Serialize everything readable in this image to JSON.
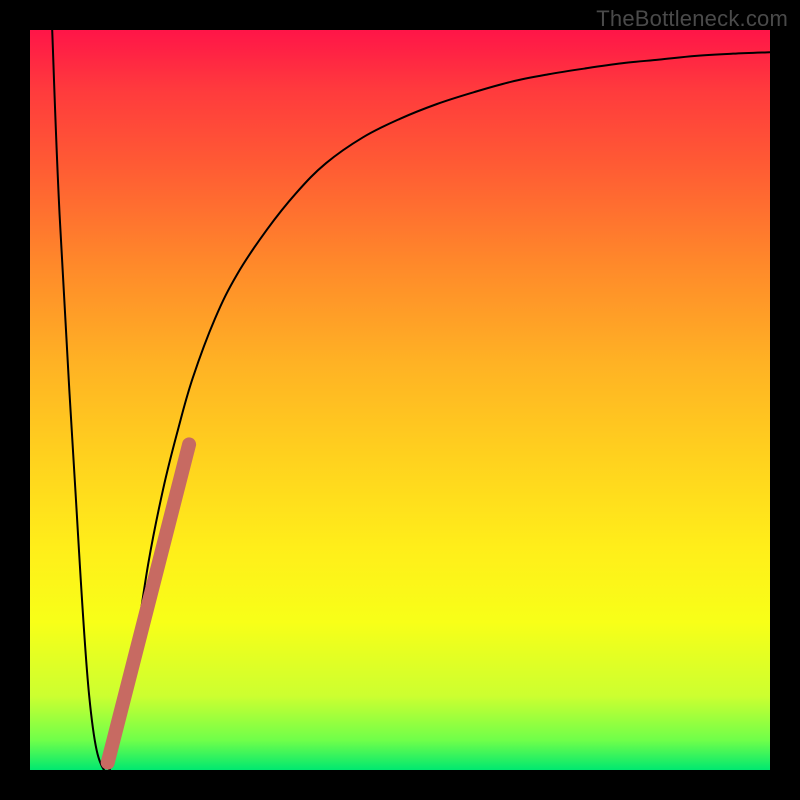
{
  "watermark": {
    "text": "TheBottleneck.com"
  },
  "colors": {
    "curve_stroke": "#000000",
    "marker_stroke": "#c76a62",
    "marker_fill": "none"
  },
  "chart_data": {
    "type": "line",
    "title": "",
    "xlabel": "",
    "ylabel": "",
    "xlim": [
      0,
      100
    ],
    "ylim": [
      0,
      100
    ],
    "grid": false,
    "legend": false,
    "series": [
      {
        "name": "bottleneck-curve",
        "x": [
          3,
          4,
          6,
          8,
          10,
          12,
          14,
          16,
          18,
          20,
          22,
          25,
          28,
          32,
          36,
          40,
          45,
          50,
          55,
          60,
          65,
          70,
          75,
          80,
          85,
          90,
          95,
          100
        ],
        "values": [
          100,
          75,
          40,
          10,
          0,
          4,
          15,
          28,
          38,
          46,
          53,
          61,
          67,
          73,
          78,
          82,
          85.5,
          88,
          90,
          91.6,
          93,
          94,
          94.8,
          95.5,
          96,
          96.5,
          96.8,
          97
        ]
      }
    ],
    "annotations": [
      {
        "name": "highlight-segment",
        "shape": "capsule",
        "x_range": [
          10.5,
          21.5
        ],
        "y_range": [
          1,
          44
        ],
        "stroke_width": 14
      }
    ]
  }
}
